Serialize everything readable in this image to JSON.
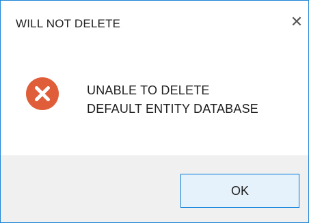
{
  "dialog": {
    "title": "WILL NOT DELETE",
    "close_glyph": "✕",
    "icon": "error-icon",
    "message_line1": "UNABLE TO DELETE",
    "message_line2": "DEFAULT ENTITY DATABASE",
    "ok_label": "OK"
  },
  "colors": {
    "border": "#1a83d6",
    "error_red": "#e05d3a",
    "footer_bg": "#f0f0f0",
    "button_bg": "#e5f1fb",
    "button_border": "#0078d7"
  }
}
